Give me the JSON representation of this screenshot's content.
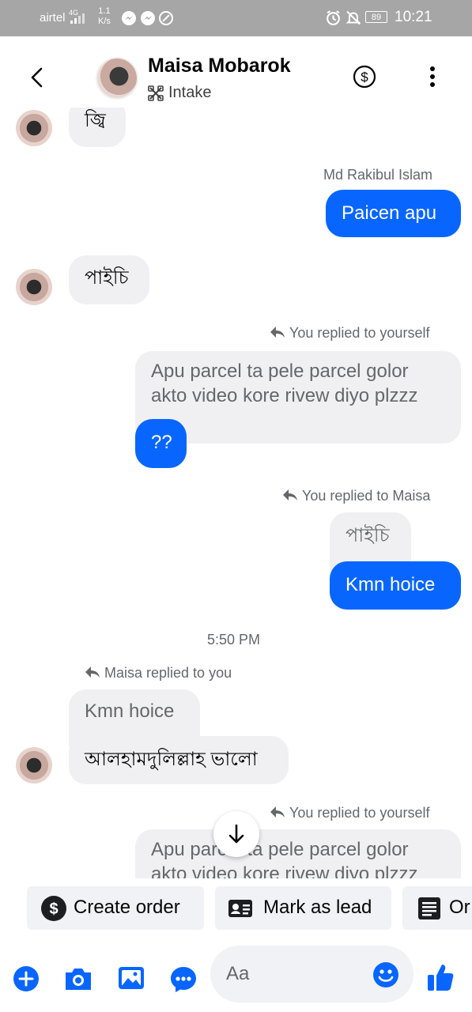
{
  "status_bar": {
    "carrier": "airtel",
    "network": "4G",
    "net_speed_value": "1.1",
    "net_speed_unit": "K/s",
    "battery": "89",
    "time": "10:21"
  },
  "header": {
    "contact_name": "Maisa Mobarok",
    "subtitle": "Intake"
  },
  "messages": {
    "m1_text": "জ্বি",
    "m2_sender": "Md Rakibul Islam",
    "m2_text": "Paicen apu",
    "m3_text": "পাইচি",
    "m4_reply_label": "You replied to yourself",
    "m4_quoted_line1": "Apu parcel ta pele parcel golor",
    "m4_quoted_line2": "akto video kore rivew diyo plzzz",
    "m4_text": "??",
    "m5_reply_label": "You replied to Maisa",
    "m5_quoted": "পাইচি",
    "m5_text": "Kmn hoice",
    "timestamp": "5:50 PM",
    "m6_reply_label": "Maisa replied to you",
    "m6_quoted": "Kmn hoice",
    "m6_text": "আলহামদুলিল্লাহ ভালো",
    "m7_reply_label": "You replied to yourself",
    "m7_quoted_line1": "Apu parcel ta pele parcel golor",
    "m7_quoted_line2": "akto video kore rivew diyo plzzz"
  },
  "quick_actions": {
    "create_order": "Create order",
    "mark_as_lead": "Mark as lead",
    "order_partial": "Or"
  },
  "composer": {
    "placeholder": "Aa"
  },
  "colors": {
    "accent": "#0866ff",
    "bubble_grey": "#f0f0f3",
    "status_bar": "#a6a6a6"
  }
}
